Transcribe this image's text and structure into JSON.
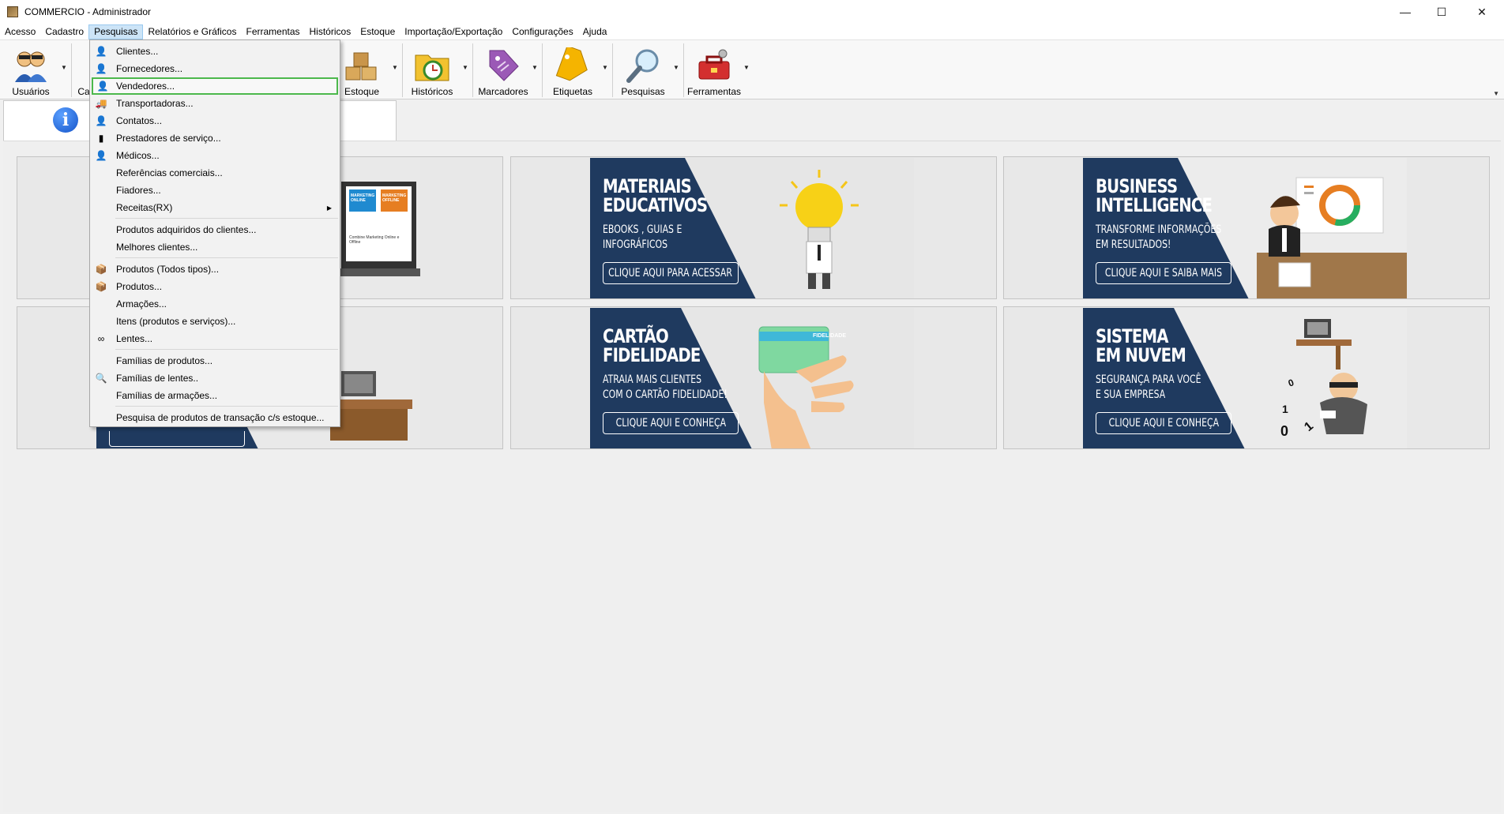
{
  "window": {
    "title": "COMMERCIO - Administrador",
    "minimize": "—",
    "maximize": "☐",
    "close": "✕"
  },
  "menubar": [
    "Acesso",
    "Cadastro",
    "Pesquisas",
    "Relatórios e Gráficos",
    "Ferramentas",
    "Históricos",
    "Estoque",
    "Importação/Exportação",
    "Configurações",
    "Ajuda"
  ],
  "toolbar": {
    "usuarios": "Usuários",
    "cadastro_partial": "Ca",
    "estoque": "Estoque",
    "historicos": "Históricos",
    "marcadores": "Marcadores",
    "etiquetas": "Etiquetas",
    "pesquisas": "Pesquisas",
    "ferramentas": "Ferramentas"
  },
  "pesquisas_menu": {
    "items": [
      "Clientes...",
      "Fornecedores...",
      "Vendedores...",
      "Transportadoras...",
      "Contatos...",
      "Prestadores de serviço...",
      "Médicos...",
      "Referências comerciais...",
      "Fiadores...",
      "Receitas(RX)",
      "Produtos adquiridos do clientes...",
      "Melhores clientes...",
      "Produtos (Todos tipos)...",
      "Produtos...",
      "Armações...",
      "Itens (produtos e serviços)...",
      "Lentes...",
      "Famílias de produtos...",
      "Famílias de lentes..",
      "Famílias de armações...",
      "Pesquisa de produtos de transação c/s estoque..."
    ],
    "highlighted": "Vendedores..."
  },
  "banners": {
    "materiais": {
      "title": "MATERIAIS\nEDUCATIVOS",
      "subtitle": "EBOOKS , GUIAS E\nINFOGRÁFICOS",
      "cta": "CLIQUE AQUI PARA ACESSAR"
    },
    "bi": {
      "title": "BUSINESS\nINTELLIGENCE",
      "subtitle": "TRANSFORME INFORMAÇÕES\nEM RESULTADOS!",
      "cta": "CLIQUE AQUI E SAIBA MAIS"
    },
    "cartao": {
      "title": "CARTÃO\nFIDELIDADE",
      "subtitle": "ATRAIA MAIS CLIENTES\nCOM O CARTÃO FIDELIDADE!",
      "cta": "CLIQUE AQUI E CONHEÇA",
      "card_label": "FIDELIDADE"
    },
    "nuvem": {
      "title": "SISTEMA\nEM NUVEM",
      "subtitle": "SEGURANÇA PARA VOCÊ\nE SUA EMPRESA",
      "cta": "CLIQUE AQUI E CONHEÇA",
      "digits": [
        "0",
        "1",
        "1",
        "0"
      ]
    },
    "laptop": {
      "screen_left": "MARKETING\nONLINE",
      "screen_right": "MARKETING\nOFFLINE",
      "caption": "Combine Marketing Online e Offline"
    }
  },
  "colors": {
    "navy": "#1f3a5f",
    "menu_active": "#cce4f7",
    "highlight_border": "#4cb84c"
  }
}
